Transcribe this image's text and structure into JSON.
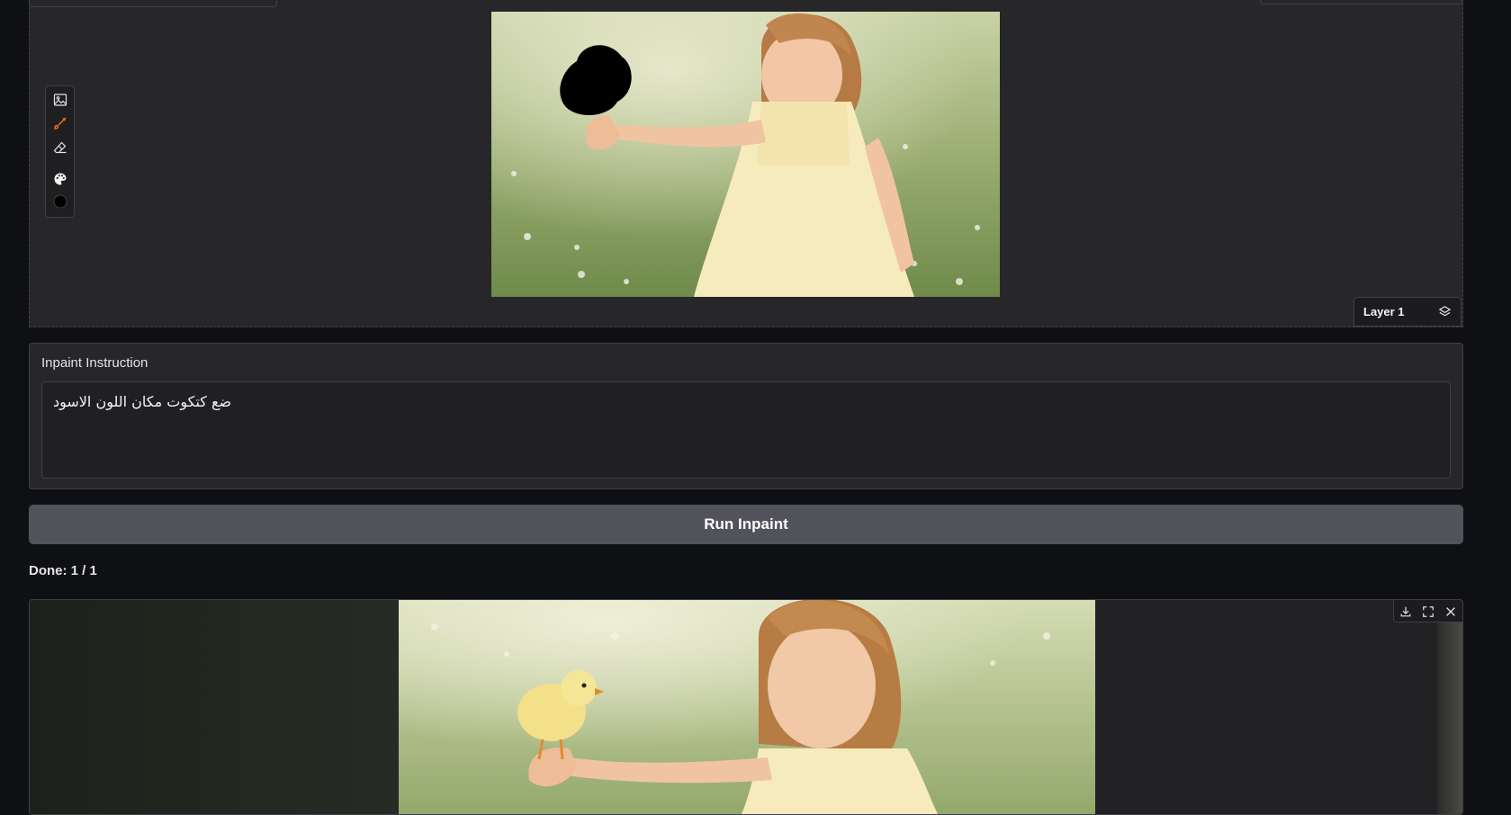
{
  "editor": {
    "tools": [
      "image-icon",
      "brush-icon",
      "eraser-icon",
      "palette-icon",
      "color-swatch"
    ],
    "active_tool": "brush-icon",
    "brush_color": "#000000",
    "layer_label": "Layer 1"
  },
  "instruction": {
    "label": "Inpaint Instruction",
    "value": "ضع كتكوت مكان اللون الاسود"
  },
  "run_button": {
    "label": "Run Inpaint"
  },
  "status": {
    "text": "Done: 1 / 1"
  },
  "output": {
    "tools": [
      "download-icon",
      "fullscreen-icon",
      "close-icon"
    ]
  },
  "colors": {
    "background": "#0f1013",
    "panel": "#27272a",
    "button": "#52525b",
    "accent_active": "#f97316"
  }
}
